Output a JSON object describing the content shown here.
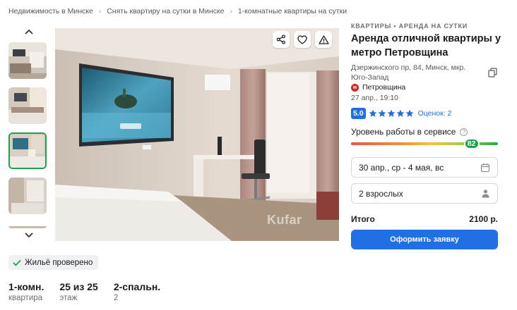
{
  "breadcrumb": [
    "Недвижимость в Минске",
    "Снять квартиру на сутки в Минске",
    "1-комнатные квартиры на сутки"
  ],
  "gallery": {
    "thumbnails": [
      {
        "alt": "living room",
        "active": false
      },
      {
        "alt": "bedroom",
        "active": false
      },
      {
        "alt": "bedroom with tv",
        "active": true
      },
      {
        "alt": "room",
        "active": false
      }
    ]
  },
  "watermark": "Kufar",
  "verified_label": "Жильё проверено",
  "facts": [
    {
      "value": "1-комн.",
      "label": "квартира"
    },
    {
      "value": "25 из 25",
      "label": "этаж"
    },
    {
      "value": "2-спальн.",
      "label": "2"
    }
  ],
  "listing": {
    "category": "КВАРТИРЫ • АРЕНДА НА СУТКИ",
    "title": "Аренда отличной квартиры у метро Петровщина",
    "address": "Дзержинского пр, 84, Минск, мкр. Юго-Запад",
    "metro_badge": "м",
    "metro": "Петровщина",
    "date": "27 апр., 19:10",
    "rating": "5.0",
    "stars": 5,
    "reviews": "Оценок: 2",
    "service_label": "Уровень работы в сервисе",
    "service_help": "?",
    "service_score": "82",
    "service_score_value": 82,
    "dates_value": "30 апр., ср - 4 мая, вс",
    "guests_value": "2 взрослых",
    "total_label": "Итого",
    "total_value": "2100 р.",
    "submit_label": "Оформить заявку"
  },
  "colors": {
    "accent": "#1f6fe5",
    "success": "#1aa34a",
    "metro": "#d9251c"
  }
}
